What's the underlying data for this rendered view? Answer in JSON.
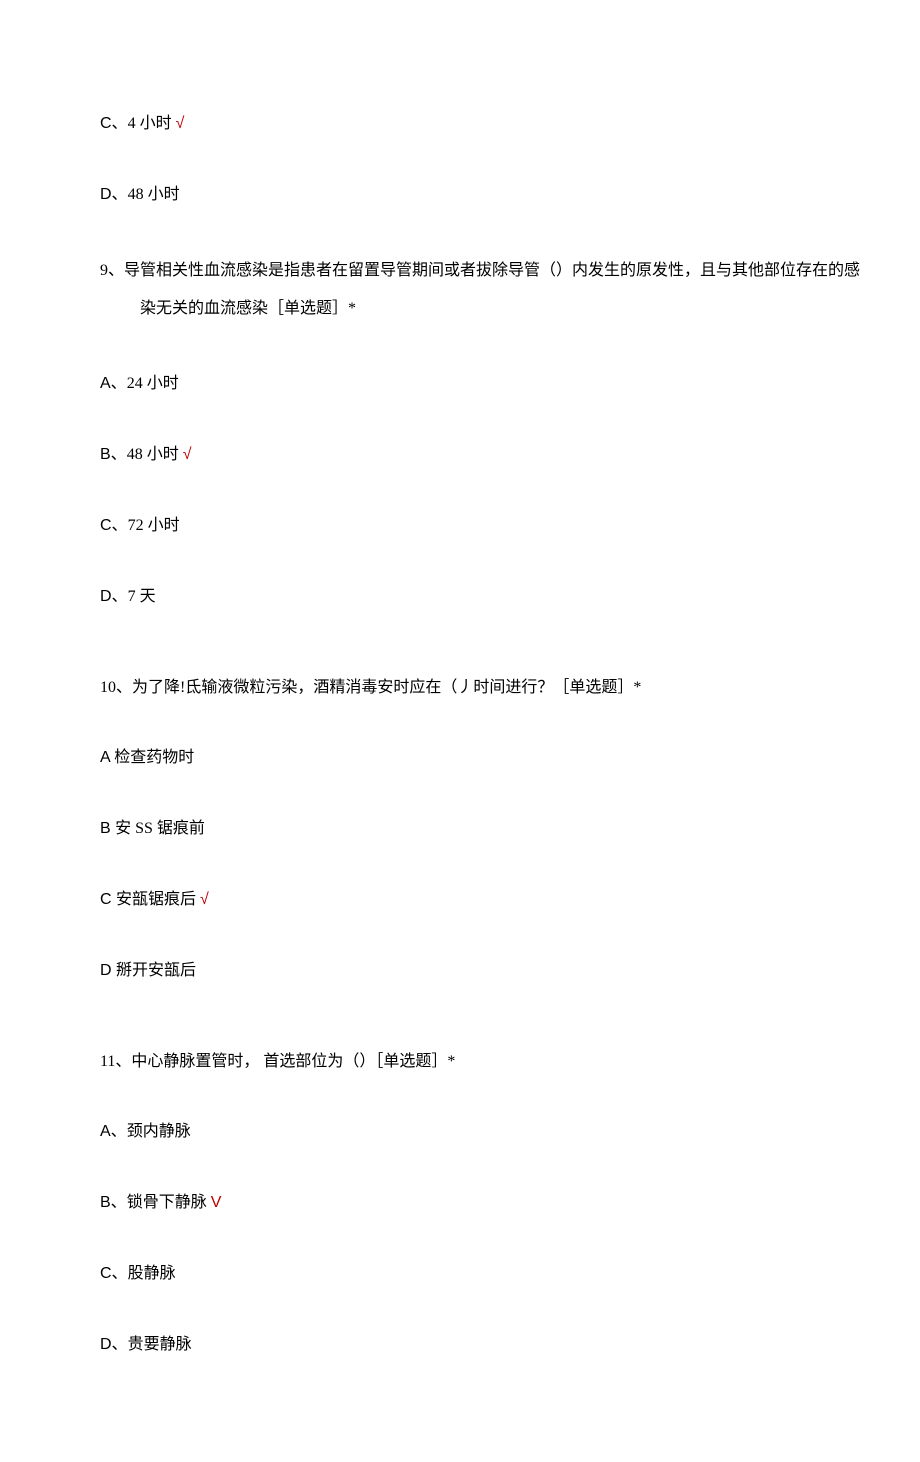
{
  "q8_continued": {
    "optC": {
      "prefix": "C、",
      "text": "4 小时",
      "mark": "√"
    },
    "optD": {
      "prefix": "D、",
      "text": "48 小时"
    }
  },
  "q9": {
    "text": "9、导管相关性血流感染是指患者在留置导管期间或者拔除导管（）内发生的原发性，且与其他部位存在的感染无关的血流感染［单选题］*",
    "optA": {
      "prefix": "A、",
      "text": "24 小时"
    },
    "optB": {
      "prefix": "B、",
      "text": "48 小时",
      "mark": "√"
    },
    "optC": {
      "prefix": "C、",
      "text": "72 小时"
    },
    "optD": {
      "prefix": "D、",
      "text": "7 天"
    }
  },
  "q10": {
    "text": "10、为了降!氐输液微粒污染，酒精消毒安时应在（丿时间进行？［单选题］*",
    "optA": {
      "prefix": "A ",
      "text": "检查药物时"
    },
    "optB": {
      "prefix": "B ",
      "text": "安 SS 锯痕前"
    },
    "optC": {
      "prefix": "C ",
      "text": "安瓿锯痕后",
      "mark": "√"
    },
    "optD": {
      "prefix": "D ",
      "text": "掰开安瓿后"
    }
  },
  "q11": {
    "text": "11、中心静脉置管时， 首选部位为（）［单选题］*",
    "optA": {
      "prefix": "A、",
      "text": "颈内静脉"
    },
    "optB": {
      "prefix": "B、",
      "text": "锁骨下静脉",
      "mark": "V"
    },
    "optC": {
      "prefix": "C、",
      "text": "股静脉"
    },
    "optD": {
      "prefix": "D、",
      "text": "贵要静脉"
    }
  }
}
